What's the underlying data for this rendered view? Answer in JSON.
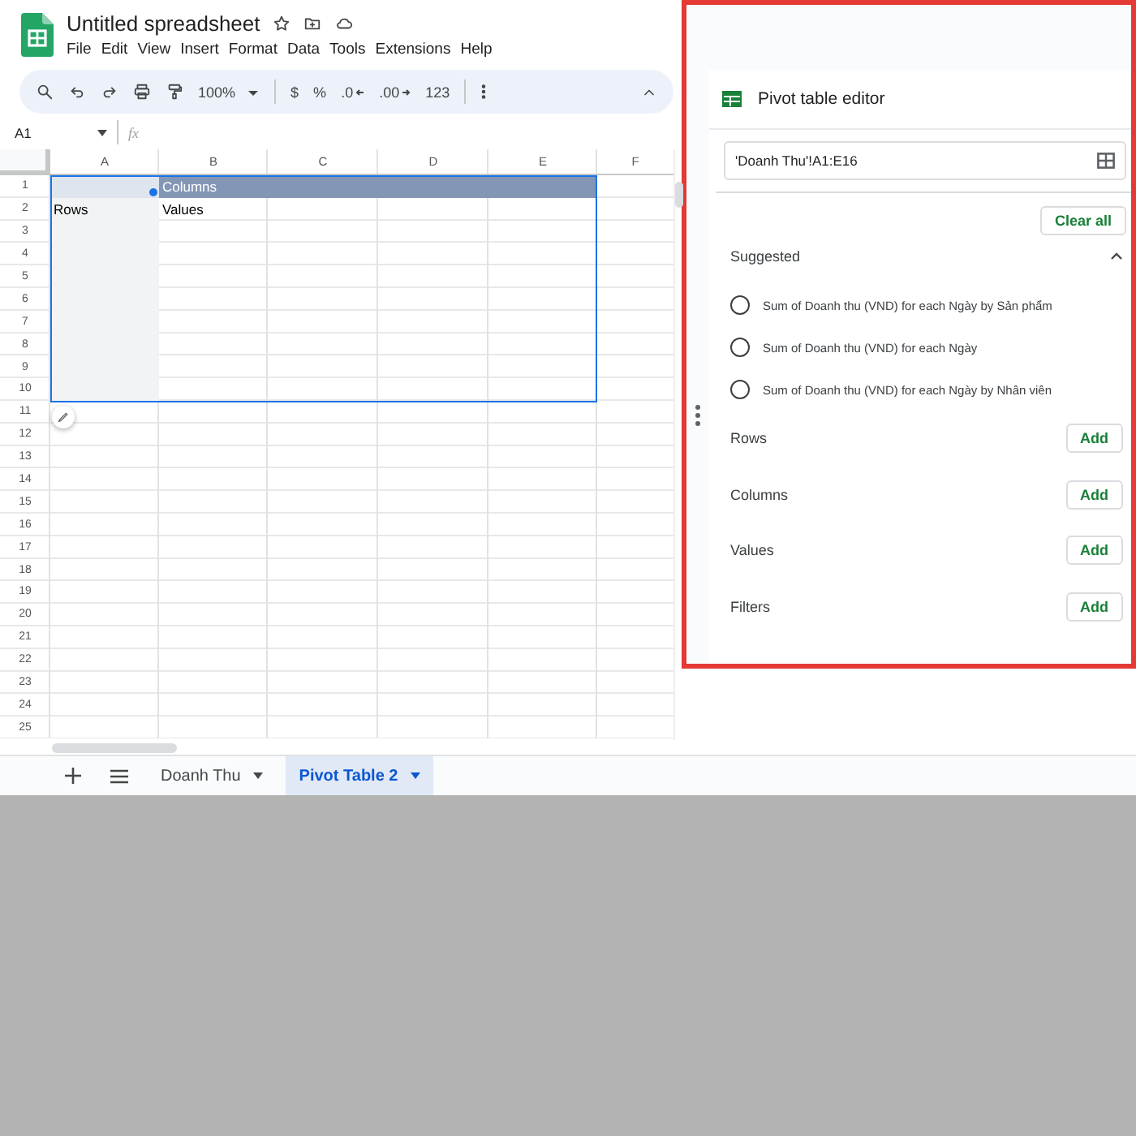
{
  "document": {
    "title": "Untitled spreadsheet"
  },
  "menu": [
    "File",
    "Edit",
    "View",
    "Insert",
    "Format",
    "Data",
    "Tools",
    "Extensions",
    "Help"
  ],
  "toolbar": {
    "zoom": "100%",
    "currency": "$",
    "percent": "%",
    "decrease_decimals": ".0",
    "increase_decimals": ".00",
    "number_format": "123"
  },
  "formula_bar": {
    "cell_ref": "A1",
    "fx": "fx"
  },
  "sheet": {
    "columns": [
      "A",
      "B",
      "C",
      "D",
      "E",
      "F"
    ],
    "rows": [
      "1",
      "2",
      "3",
      "4",
      "5",
      "6",
      "7",
      "8",
      "9",
      "10",
      "11",
      "12",
      "13",
      "14",
      "15",
      "16",
      "17",
      "18",
      "19",
      "20",
      "21",
      "22",
      "23",
      "24",
      "25"
    ],
    "pivot": {
      "columns_label": "Columns",
      "rows_label": "Rows",
      "values_label": "Values"
    }
  },
  "sheet_tabs": [
    {
      "label": "Doanh Thu",
      "selected": false
    },
    {
      "label": "Pivot Table 2",
      "selected": true
    }
  ],
  "pivot_editor": {
    "title": "Pivot table editor",
    "source_range": "'Doanh Thu'!A1:E16",
    "clear_button": "Clear all",
    "suggested": {
      "label": "Suggested",
      "expanded": true,
      "items": [
        {
          "label": "Sum of Doanh thu (VND) for each Ngày by Sản phẩm",
          "selected": false
        },
        {
          "label": "Sum of Doanh thu (VND) for each Ngày",
          "selected": false
        },
        {
          "label": "Sum of Doanh thu (VND) for each Ngày by Nhân viên",
          "selected": false
        }
      ]
    },
    "sections": [
      {
        "label": "Rows",
        "button": "Add"
      },
      {
        "label": "Columns",
        "button": "Add"
      },
      {
        "label": "Values",
        "button": "Add"
      },
      {
        "label": "Filters",
        "button": "Add"
      }
    ]
  }
}
